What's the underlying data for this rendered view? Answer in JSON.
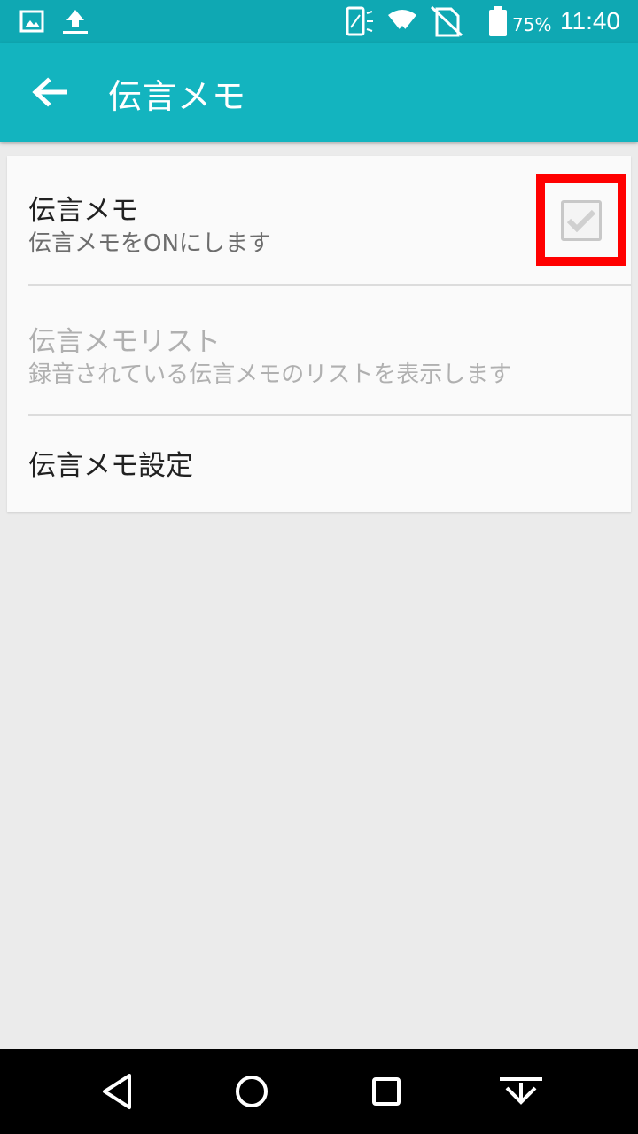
{
  "status_bar": {
    "battery_percent": "75%",
    "time": "11:40",
    "icons": [
      "image-icon",
      "upload-icon",
      "vibrate-icon",
      "wifi-icon",
      "no-sim-icon",
      "battery-icon"
    ]
  },
  "app_bar": {
    "title": "伝言メモ"
  },
  "preferences": [
    {
      "title": "伝言メモ",
      "summary": "伝言メモをONにします",
      "checked": true,
      "enabled": true
    },
    {
      "title": "伝言メモリスト",
      "summary": "録音されている伝言メモのリストを表示します",
      "enabled": false
    },
    {
      "title": "伝言メモ設定",
      "enabled": true
    }
  ],
  "colors": {
    "accent": "#13b4bf",
    "highlight": "#ff0000"
  },
  "nav_bar": {
    "icons": [
      "back-triangle-icon",
      "home-circle-icon",
      "recents-square-icon",
      "notification-pull-icon"
    ]
  }
}
